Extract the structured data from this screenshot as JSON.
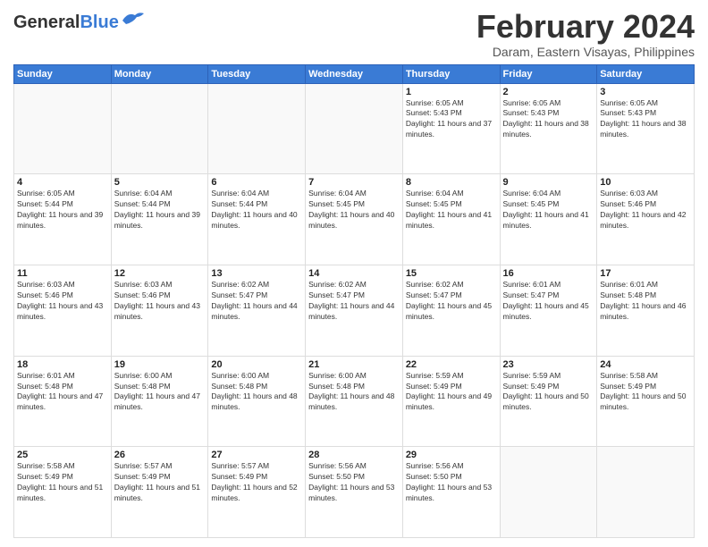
{
  "header": {
    "logo_line1": "General",
    "logo_line2": "Blue",
    "month": "February 2024",
    "location": "Daram, Eastern Visayas, Philippines"
  },
  "weekdays": [
    "Sunday",
    "Monday",
    "Tuesday",
    "Wednesday",
    "Thursday",
    "Friday",
    "Saturday"
  ],
  "days": [
    {
      "day": "",
      "sunrise": "",
      "sunset": "",
      "daylight": "",
      "empty": true
    },
    {
      "day": "",
      "sunrise": "",
      "sunset": "",
      "daylight": "",
      "empty": true
    },
    {
      "day": "",
      "sunrise": "",
      "sunset": "",
      "daylight": "",
      "empty": true
    },
    {
      "day": "",
      "sunrise": "",
      "sunset": "",
      "daylight": "",
      "empty": true
    },
    {
      "day": "1",
      "sunrise": "Sunrise: 6:05 AM",
      "sunset": "Sunset: 5:43 PM",
      "daylight": "Daylight: 11 hours and 37 minutes.",
      "empty": false
    },
    {
      "day": "2",
      "sunrise": "Sunrise: 6:05 AM",
      "sunset": "Sunset: 5:43 PM",
      "daylight": "Daylight: 11 hours and 38 minutes.",
      "empty": false
    },
    {
      "day": "3",
      "sunrise": "Sunrise: 6:05 AM",
      "sunset": "Sunset: 5:43 PM",
      "daylight": "Daylight: 11 hours and 38 minutes.",
      "empty": false
    },
    {
      "day": "4",
      "sunrise": "Sunrise: 6:05 AM",
      "sunset": "Sunset: 5:44 PM",
      "daylight": "Daylight: 11 hours and 39 minutes.",
      "empty": false
    },
    {
      "day": "5",
      "sunrise": "Sunrise: 6:04 AM",
      "sunset": "Sunset: 5:44 PM",
      "daylight": "Daylight: 11 hours and 39 minutes.",
      "empty": false
    },
    {
      "day": "6",
      "sunrise": "Sunrise: 6:04 AM",
      "sunset": "Sunset: 5:44 PM",
      "daylight": "Daylight: 11 hours and 40 minutes.",
      "empty": false
    },
    {
      "day": "7",
      "sunrise": "Sunrise: 6:04 AM",
      "sunset": "Sunset: 5:45 PM",
      "daylight": "Daylight: 11 hours and 40 minutes.",
      "empty": false
    },
    {
      "day": "8",
      "sunrise": "Sunrise: 6:04 AM",
      "sunset": "Sunset: 5:45 PM",
      "daylight": "Daylight: 11 hours and 41 minutes.",
      "empty": false
    },
    {
      "day": "9",
      "sunrise": "Sunrise: 6:04 AM",
      "sunset": "Sunset: 5:45 PM",
      "daylight": "Daylight: 11 hours and 41 minutes.",
      "empty": false
    },
    {
      "day": "10",
      "sunrise": "Sunrise: 6:03 AM",
      "sunset": "Sunset: 5:46 PM",
      "daylight": "Daylight: 11 hours and 42 minutes.",
      "empty": false
    },
    {
      "day": "11",
      "sunrise": "Sunrise: 6:03 AM",
      "sunset": "Sunset: 5:46 PM",
      "daylight": "Daylight: 11 hours and 43 minutes.",
      "empty": false
    },
    {
      "day": "12",
      "sunrise": "Sunrise: 6:03 AM",
      "sunset": "Sunset: 5:46 PM",
      "daylight": "Daylight: 11 hours and 43 minutes.",
      "empty": false
    },
    {
      "day": "13",
      "sunrise": "Sunrise: 6:02 AM",
      "sunset": "Sunset: 5:47 PM",
      "daylight": "Daylight: 11 hours and 44 minutes.",
      "empty": false
    },
    {
      "day": "14",
      "sunrise": "Sunrise: 6:02 AM",
      "sunset": "Sunset: 5:47 PM",
      "daylight": "Daylight: 11 hours and 44 minutes.",
      "empty": false
    },
    {
      "day": "15",
      "sunrise": "Sunrise: 6:02 AM",
      "sunset": "Sunset: 5:47 PM",
      "daylight": "Daylight: 11 hours and 45 minutes.",
      "empty": false
    },
    {
      "day": "16",
      "sunrise": "Sunrise: 6:01 AM",
      "sunset": "Sunset: 5:47 PM",
      "daylight": "Daylight: 11 hours and 45 minutes.",
      "empty": false
    },
    {
      "day": "17",
      "sunrise": "Sunrise: 6:01 AM",
      "sunset": "Sunset: 5:48 PM",
      "daylight": "Daylight: 11 hours and 46 minutes.",
      "empty": false
    },
    {
      "day": "18",
      "sunrise": "Sunrise: 6:01 AM",
      "sunset": "Sunset: 5:48 PM",
      "daylight": "Daylight: 11 hours and 47 minutes.",
      "empty": false
    },
    {
      "day": "19",
      "sunrise": "Sunrise: 6:00 AM",
      "sunset": "Sunset: 5:48 PM",
      "daylight": "Daylight: 11 hours and 47 minutes.",
      "empty": false
    },
    {
      "day": "20",
      "sunrise": "Sunrise: 6:00 AM",
      "sunset": "Sunset: 5:48 PM",
      "daylight": "Daylight: 11 hours and 48 minutes.",
      "empty": false
    },
    {
      "day": "21",
      "sunrise": "Sunrise: 6:00 AM",
      "sunset": "Sunset: 5:48 PM",
      "daylight": "Daylight: 11 hours and 48 minutes.",
      "empty": false
    },
    {
      "day": "22",
      "sunrise": "Sunrise: 5:59 AM",
      "sunset": "Sunset: 5:49 PM",
      "daylight": "Daylight: 11 hours and 49 minutes.",
      "empty": false
    },
    {
      "day": "23",
      "sunrise": "Sunrise: 5:59 AM",
      "sunset": "Sunset: 5:49 PM",
      "daylight": "Daylight: 11 hours and 50 minutes.",
      "empty": false
    },
    {
      "day": "24",
      "sunrise": "Sunrise: 5:58 AM",
      "sunset": "Sunset: 5:49 PM",
      "daylight": "Daylight: 11 hours and 50 minutes.",
      "empty": false
    },
    {
      "day": "25",
      "sunrise": "Sunrise: 5:58 AM",
      "sunset": "Sunset: 5:49 PM",
      "daylight": "Daylight: 11 hours and 51 minutes.",
      "empty": false
    },
    {
      "day": "26",
      "sunrise": "Sunrise: 5:57 AM",
      "sunset": "Sunset: 5:49 PM",
      "daylight": "Daylight: 11 hours and 51 minutes.",
      "empty": false
    },
    {
      "day": "27",
      "sunrise": "Sunrise: 5:57 AM",
      "sunset": "Sunset: 5:49 PM",
      "daylight": "Daylight: 11 hours and 52 minutes.",
      "empty": false
    },
    {
      "day": "28",
      "sunrise": "Sunrise: 5:56 AM",
      "sunset": "Sunset: 5:50 PM",
      "daylight": "Daylight: 11 hours and 53 minutes.",
      "empty": false
    },
    {
      "day": "29",
      "sunrise": "Sunrise: 5:56 AM",
      "sunset": "Sunset: 5:50 PM",
      "daylight": "Daylight: 11 hours and 53 minutes.",
      "empty": false
    },
    {
      "day": "",
      "sunrise": "",
      "sunset": "",
      "daylight": "",
      "empty": true
    },
    {
      "day": "",
      "sunrise": "",
      "sunset": "",
      "daylight": "",
      "empty": true
    }
  ]
}
